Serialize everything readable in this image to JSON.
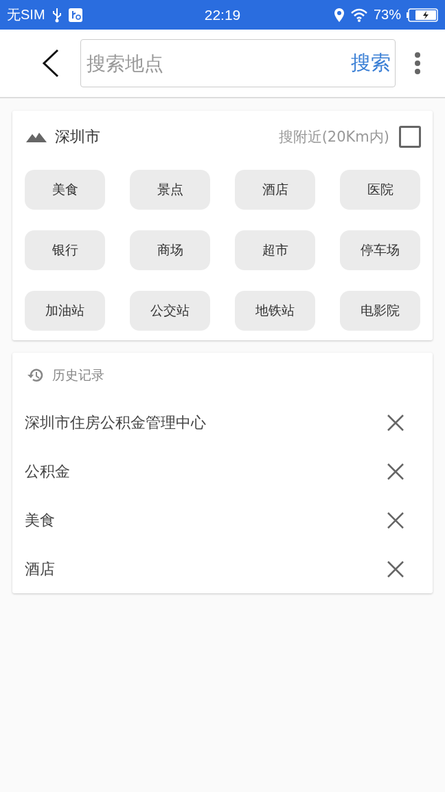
{
  "status_bar": {
    "carrier": "无SIM",
    "time": "22:19",
    "battery": "73%"
  },
  "search_bar": {
    "placeholder": "搜索地点",
    "button": "搜索"
  },
  "city_card": {
    "city": "深圳市",
    "nearby_label": "搜附近(20Km内)",
    "nearby_checked": false,
    "categories": [
      "美食",
      "景点",
      "酒店",
      "医院",
      "银行",
      "商场",
      "超市",
      "停车场",
      "加油站",
      "公交站",
      "地铁站",
      "电影院"
    ]
  },
  "history": {
    "title": "历史记录",
    "items": [
      "深圳市住房公积金管理中心",
      "公积金",
      "美食",
      "酒店"
    ]
  }
}
